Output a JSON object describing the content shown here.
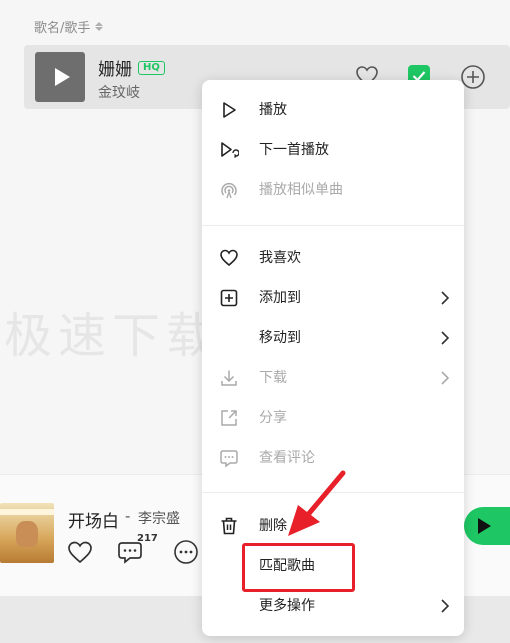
{
  "list": {
    "column_header": "歌名/歌手",
    "song": {
      "title": "姗姗",
      "quality_badge": "HQ",
      "artist": "金玟岐"
    }
  },
  "watermark": "极速下载",
  "player": {
    "title": "开场白",
    "separator": "-",
    "artist": "李宗盛",
    "comment_count": "217"
  },
  "menu": {
    "items": [
      {
        "label": "播放",
        "icon": "play-icon",
        "enabled": true
      },
      {
        "label": "下一首播放",
        "icon": "play-next-icon",
        "enabled": true
      },
      {
        "label": "播放相似单曲",
        "icon": "radar-icon",
        "enabled": false
      },
      {
        "label": "我喜欢",
        "icon": "heart-icon",
        "enabled": true
      },
      {
        "label": "添加到",
        "icon": "add-box-icon",
        "enabled": true,
        "submenu": true
      },
      {
        "label": "移动到",
        "icon": "",
        "enabled": true,
        "submenu": true
      },
      {
        "label": "下载",
        "icon": "download-icon",
        "enabled": false,
        "submenu": true
      },
      {
        "label": "分享",
        "icon": "share-icon",
        "enabled": false
      },
      {
        "label": "查看评论",
        "icon": "comment-icon",
        "enabled": false
      },
      {
        "label": "删除",
        "icon": "trash-icon",
        "enabled": true
      },
      {
        "label": "匹配歌曲",
        "icon": "",
        "enabled": true
      },
      {
        "label": "更多操作",
        "icon": "",
        "enabled": true,
        "submenu": true
      }
    ]
  },
  "colors": {
    "accent": "#1ec764",
    "highlight": "#e8202a"
  }
}
